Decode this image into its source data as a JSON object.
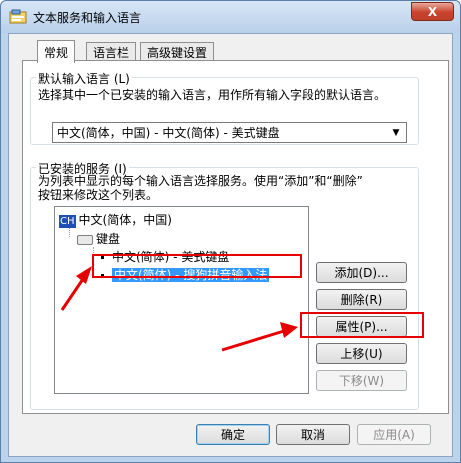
{
  "window": {
    "title": "文本服务和输入语言",
    "close_label": "X"
  },
  "tabs": [
    {
      "label": "常规"
    },
    {
      "label": "语言栏"
    },
    {
      "label": "高级键设置"
    }
  ],
  "default_language": {
    "caption": "默认输入语言 (L)",
    "description": "选择其中一个已安装的输入语言，用作所有输入字段的默认语言。",
    "selected": "中文(简体，中国) - 中文(简体) - 美式键盘"
  },
  "installed_services": {
    "caption": "已安装的服务 (I)",
    "description_line1": "为列表中显示的每个输入语言选择服务。使用“添加”和“删除”",
    "description_line2": "按钮来修改这个列表。",
    "tree": {
      "language_badge": "CH",
      "language": "中文(简体，中国)",
      "keyboard_group": "键盘",
      "items": [
        "中文(简体) - 美式键盘",
        "中文(简体) - 搜狗拼音输入法"
      ]
    }
  },
  "side_buttons": {
    "add": "添加(D)...",
    "remove": "删除(R)",
    "properties": "属性(P)...",
    "move_up": "上移(U)",
    "move_down": "下移(W)"
  },
  "footer": {
    "ok": "确定",
    "cancel": "取消",
    "apply": "应用(A)"
  },
  "colors": {
    "annotation": "#e60000",
    "selection": "#3399ff"
  }
}
